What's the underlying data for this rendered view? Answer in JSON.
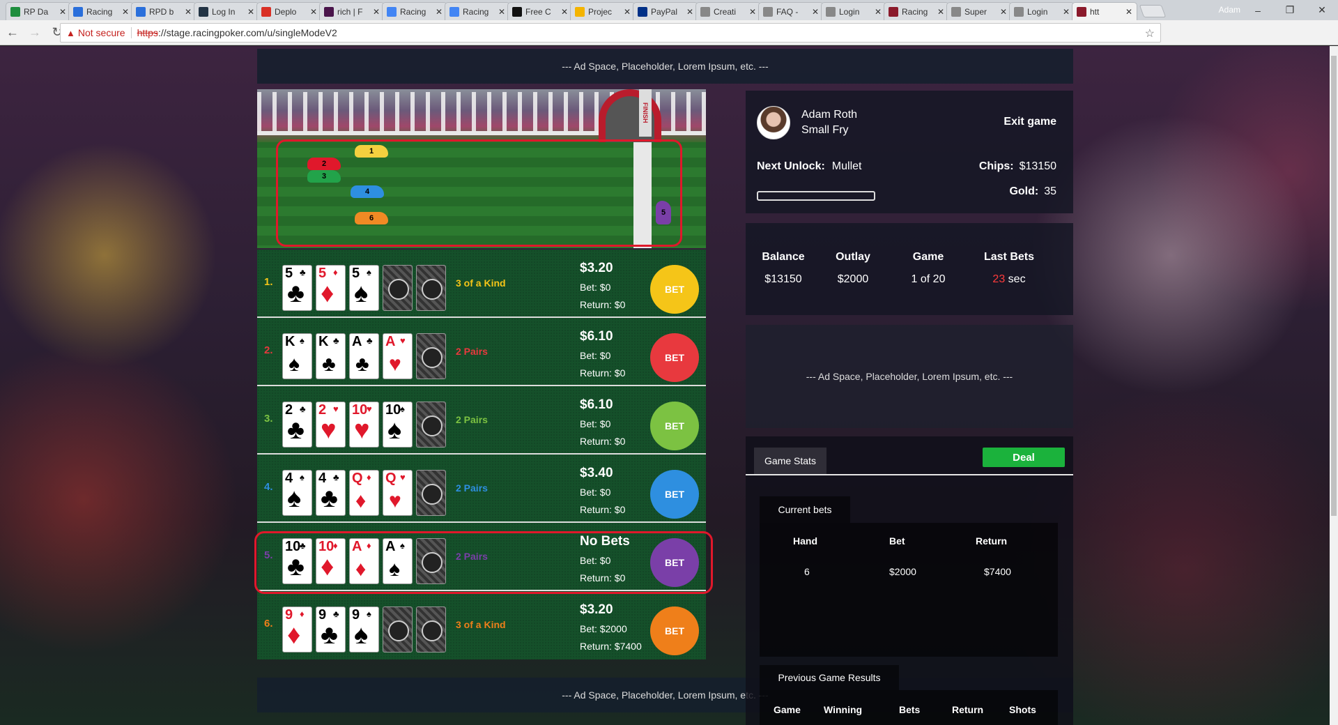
{
  "browser": {
    "tabs": [
      {
        "label": "RP Da",
        "color": "#1e8e3e"
      },
      {
        "label": "Racing",
        "color": "#2a6fdb"
      },
      {
        "label": "RPD b",
        "color": "#2a6fdb"
      },
      {
        "label": "Log In",
        "color": "#234"
      },
      {
        "label": "Deplo",
        "color": "#d93025"
      },
      {
        "label": "rich | F",
        "color": "#4a154b"
      },
      {
        "label": "Racing",
        "color": "#4285f4"
      },
      {
        "label": "Racing",
        "color": "#4285f4"
      },
      {
        "label": "Free C",
        "color": "#111"
      },
      {
        "label": "Projec",
        "color": "#f4b400"
      },
      {
        "label": "PayPal",
        "color": "#003087"
      },
      {
        "label": "Creati",
        "color": "#888"
      },
      {
        "label": "FAQ -",
        "color": "#888"
      },
      {
        "label": "Login",
        "color": "#888"
      },
      {
        "label": "Racing",
        "color": "#8b1a2b"
      },
      {
        "label": "Super",
        "color": "#888"
      },
      {
        "label": "Login",
        "color": "#888"
      },
      {
        "label": "htt",
        "color": "#8b1a2b"
      }
    ],
    "user": "Adam",
    "not_secure": "Not secure",
    "url_scheme": "https",
    "url_rest": "://stage.racingpoker.com/u/singleModeV2"
  },
  "ads": {
    "top": "--- Ad Space, Placeholder, Lorem Ipsum, etc. ---",
    "mid": "--- Ad Space, Placeholder, Lorem Ipsum, etc. ---",
    "bottom": "--- Ad Space, Placeholder, Lorem Ipsum, etc. ---"
  },
  "track": {
    "finish_label": "FINISH",
    "horses": [
      {
        "num": "1",
        "color": "#f4d03f"
      },
      {
        "num": "2",
        "color": "#e0182b"
      },
      {
        "num": "3",
        "color": "#22a34a"
      },
      {
        "num": "4",
        "color": "#2e8fe0"
      },
      {
        "num": "5",
        "color": "#7a3fa8"
      },
      {
        "num": "6",
        "color": "#f08a24"
      }
    ]
  },
  "hands": [
    {
      "num": "1.",
      "color": "#f5c518",
      "name": "3 of a Kind",
      "odds": "$3.20",
      "bet": "Bet: $0",
      "ret": "Return: $0",
      "btn": "BET",
      "cards": [
        [
          "5",
          "♣",
          "blk"
        ],
        [
          "5",
          "♦",
          "red"
        ],
        [
          "5",
          "♠",
          "blk"
        ],
        [
          "back"
        ],
        [
          "back"
        ]
      ]
    },
    {
      "num": "2.",
      "color": "#e8393e",
      "name": "2 Pairs",
      "odds": "$6.10",
      "bet": "Bet: $0",
      "ret": "Return: $0",
      "btn": "BET",
      "cards": [
        [
          "K",
          "♠",
          "blk"
        ],
        [
          "K",
          "♣",
          "blk"
        ],
        [
          "A",
          "♣",
          "blk"
        ],
        [
          "A",
          "♥",
          "red"
        ],
        [
          "back"
        ]
      ]
    },
    {
      "num": "3.",
      "color": "#7cc242",
      "name": "2 Pairs",
      "odds": "$6.10",
      "bet": "Bet: $0",
      "ret": "Return: $0",
      "btn": "BET",
      "cards": [
        [
          "2",
          "♣",
          "blk"
        ],
        [
          "2",
          "♥",
          "red"
        ],
        [
          "10",
          "♥",
          "red"
        ],
        [
          "10",
          "♠",
          "blk"
        ],
        [
          "back"
        ]
      ]
    },
    {
      "num": "4.",
      "color": "#2e8fe0",
      "name": "2 Pairs",
      "odds": "$3.40",
      "bet": "Bet: $0",
      "ret": "Return: $0",
      "btn": "BET",
      "cards": [
        [
          "4",
          "♠",
          "blk"
        ],
        [
          "4",
          "♣",
          "blk"
        ],
        [
          "Q",
          "♦",
          "red"
        ],
        [
          "Q",
          "♥",
          "red"
        ],
        [
          "back"
        ]
      ]
    },
    {
      "num": "5.",
      "color": "#7a3fa8",
      "name": "2 Pairs",
      "odds": "No Bets",
      "bet": "Bet: $0",
      "ret": "Return: $0",
      "btn": "BET",
      "cards": [
        [
          "10",
          "♣",
          "blk"
        ],
        [
          "10",
          "♦",
          "red"
        ],
        [
          "A",
          "♦",
          "red"
        ],
        [
          "A",
          "♠",
          "blk"
        ],
        [
          "back"
        ]
      ]
    },
    {
      "num": "6.",
      "color": "#ef7f1a",
      "name": "3 of a Kind",
      "odds": "$3.20",
      "bet": "Bet: $2000",
      "ret": "Return: $7400",
      "btn": "BET",
      "cards": [
        [
          "9",
          "♦",
          "red"
        ],
        [
          "9",
          "♣",
          "blk"
        ],
        [
          "9",
          "♠",
          "blk"
        ],
        [
          "back"
        ],
        [
          "back"
        ]
      ]
    }
  ],
  "profile": {
    "name": "Adam Roth",
    "rank": "Small Fry",
    "exit": "Exit game",
    "next_unlock_label": "Next Unlock:",
    "next_unlock_value": "Mullet",
    "chips_label": "Chips:",
    "chips_value": "$13150",
    "gold_label": "Gold:",
    "gold_value": "35",
    "unlock_progress": 0
  },
  "stats": {
    "balance_label": "Balance",
    "balance_value": "$13150",
    "outlay_label": "Outlay",
    "outlay_value": "$2000",
    "game_label": "Game",
    "game_value": "1 of 20",
    "last_label": "Last Bets",
    "last_value": "23",
    "last_unit": "sec"
  },
  "game_stats": {
    "tab": "Game Stats",
    "deal": "Deal",
    "current_bets_tab": "Current bets",
    "headers": [
      "Hand",
      "Bet",
      "Return"
    ],
    "rows": [
      [
        "6",
        "$2000",
        "$7400"
      ]
    ],
    "previous_tab": "Previous Game Results",
    "prev_headers": [
      "Game",
      "Winning",
      "Bets",
      "Return",
      "Shots"
    ]
  }
}
